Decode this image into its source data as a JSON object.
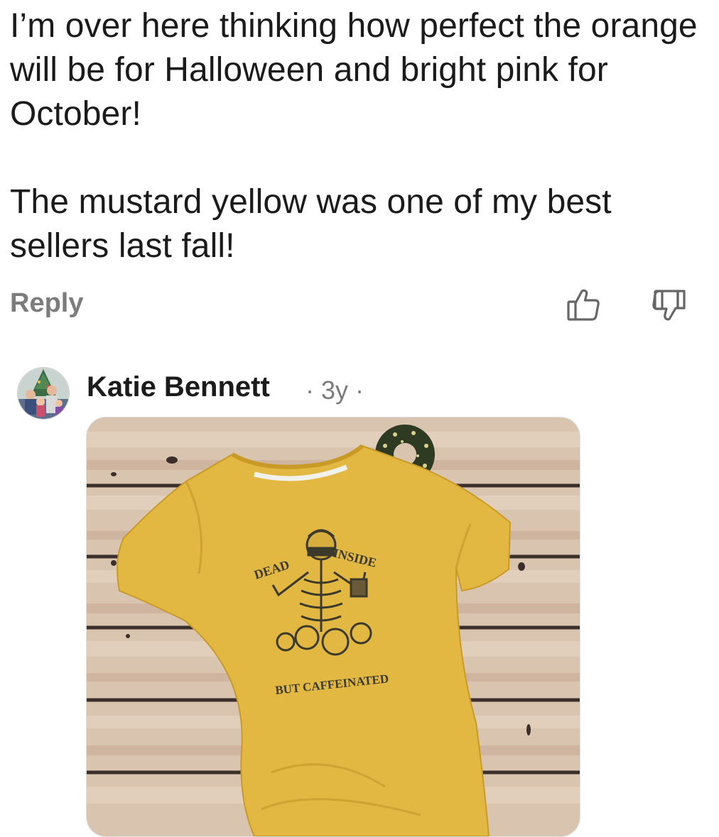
{
  "comment": {
    "paragraphs": [
      "I’m over here thinking how perfect the orange will be for Halloween and bright pink for October!",
      "The mustard yellow was one of my best sellers last fall!"
    ],
    "reply_label": "Reply",
    "upvote_icon": "thumbs-up-outline-icon",
    "downvote_icon": "thumbs-down-outline-icon"
  },
  "reply": {
    "author": "Katie Bennett",
    "meta": "· 3y ·",
    "avatar_icon": "family-photo-avatar",
    "image": {
      "description_icon": "mustard-shirt-photo",
      "shirt_text_top_left": "DEAD",
      "shirt_text_top_right": "INSIDE",
      "shirt_text_bottom": "BUT CAFFEINATED"
    }
  },
  "colors": {
    "text": "#1b1b1b",
    "muted": "#7c7c7c",
    "shirt": "#e2b842",
    "wood": "#d8c2ad"
  }
}
